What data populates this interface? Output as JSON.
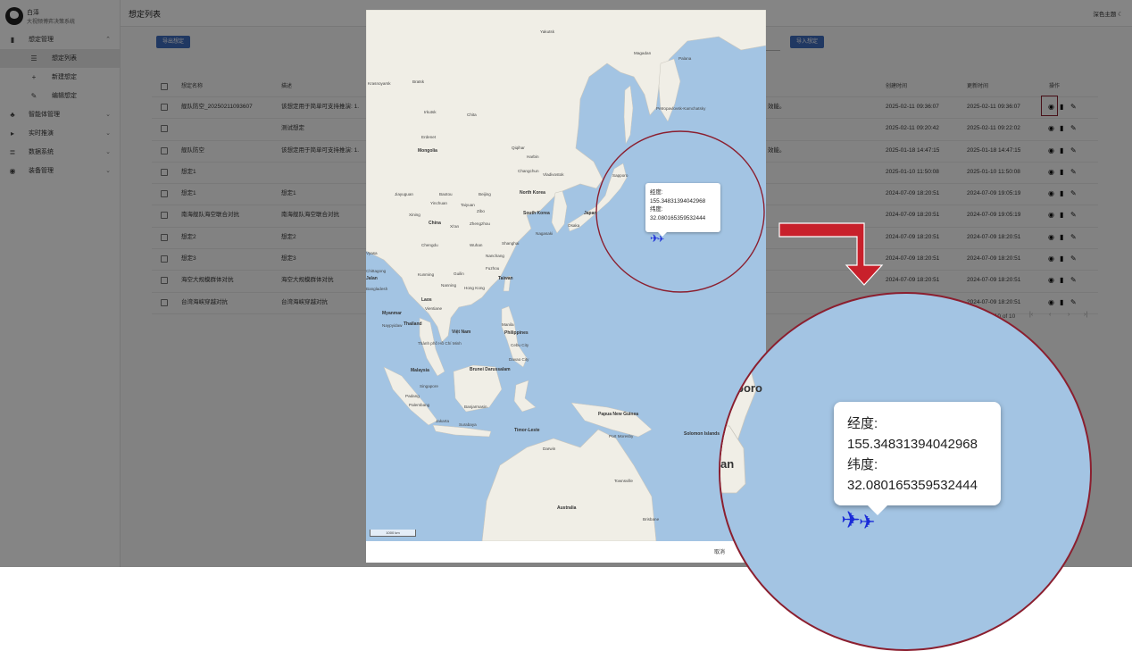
{
  "brand": {
    "title": "白泽",
    "subtitle": "大视频博弈决策系统"
  },
  "sidebar": {
    "items": [
      {
        "label": "想定管理",
        "icon": "map-icon",
        "chevron": "⌃"
      },
      {
        "label": "想定列表",
        "icon": "list-icon"
      },
      {
        "label": "新建想定",
        "icon": "plus-icon"
      },
      {
        "label": "编辑想定",
        "icon": "pencil-icon"
      },
      {
        "label": "智能体管理",
        "icon": "robot-icon",
        "chevron": "⌄"
      },
      {
        "label": "实时推演",
        "icon": "play-icon",
        "chevron": "⌄"
      },
      {
        "label": "数据系统",
        "icon": "database-icon",
        "chevron": "⌄"
      },
      {
        "label": "装备管理",
        "icon": "compass-icon",
        "chevron": "⌄"
      }
    ]
  },
  "header": {
    "title": "想定列表",
    "theme_toggle": "深色主题"
  },
  "toolbar": {
    "export_label": "导出想定",
    "import_label": "导入想定"
  },
  "table": {
    "headers": {
      "name": "想定名称",
      "desc": "描述",
      "created": "创建时间",
      "updated": "更新时间",
      "ops": "操作"
    },
    "rows": [
      {
        "name": "舰队防空_20250211093607",
        "desc": "该想定用于简单可支持推演: 1.",
        "extra": "效能。",
        "created": "2025-02-11 09:36:07",
        "updated": "2025-02-11 09:36:07"
      },
      {
        "name": "",
        "desc": "测试想定",
        "extra": "",
        "created": "2025-02-11 09:20:42",
        "updated": "2025-02-11 09:22:02"
      },
      {
        "name": "舰队防空",
        "desc": "该想定用于简单可支持推演: 1.",
        "extra": "效能。",
        "created": "2025-01-18 14:47:15",
        "updated": "2025-01-18 14:47:15"
      },
      {
        "name": "想定1",
        "desc": "",
        "extra": "",
        "created": "2025-01-10 11:50:08",
        "updated": "2025-01-10 11:50:08"
      },
      {
        "name": "想定1",
        "desc": "想定1",
        "extra": "",
        "created": "2024-07-09 18:20:51",
        "updated": "2024-07-09 19:05:19"
      },
      {
        "name": "南海舰队海空联合对抗",
        "desc": "南海舰队海空联合对抗",
        "extra": "",
        "created": "2024-07-09 18:20:51",
        "updated": "2024-07-09 19:05:19"
      },
      {
        "name": "想定2",
        "desc": "想定2",
        "extra": "",
        "created": "2024-07-09 18:20:51",
        "updated": "2024-07-09 18:20:51"
      },
      {
        "name": "想定3",
        "desc": "想定3",
        "extra": "",
        "created": "2024-07-09 18:20:51",
        "updated": "2024-07-09 18:20:51"
      },
      {
        "name": "海空大规模群体对抗",
        "desc": "海空大规模群体对抗",
        "extra": "",
        "created": "2024-07-09 18:20:51",
        "updated": "2024-07-09 18:20:51"
      },
      {
        "name": "台湾海峡穿越对抗",
        "desc": "台湾海峡穿越对抗",
        "extra": "",
        "created": "2024-07-09 18:20:51",
        "updated": "2024-07-09 18:20:51"
      }
    ],
    "pagination": "1-10 of 10"
  },
  "dialog": {
    "cancel_label": "取消",
    "popup": {
      "lon_label": "经度:",
      "lon": "155.34831394042968",
      "lat_label": "纬度:",
      "lat": "32.080165359532444"
    },
    "scale": "1000 km",
    "map_labels": [
      "Yakutsk",
      "Magadan",
      "Palana",
      "Krasnoyarsk",
      "Bratsk",
      "Irkutsk",
      "Chita",
      "Petropavlovsk-Kamchatsky",
      "Erdenet",
      "Mongolia",
      "Qiqihar",
      "Harbin",
      "Changchun",
      "Vladivostok",
      "Sapporo",
      "Baotou",
      "Beijing",
      "North Korea",
      "Jiayuguan",
      "Yinchuan",
      "Taiyuan",
      "Xining",
      "Zibo",
      "South Korea",
      "China",
      "Xi'an",
      "Zhengzhou",
      "Japan",
      "Osaka",
      "Nagasaki",
      "Chengdu",
      "Wuhan",
      "Shanghai",
      "Nanchang",
      "Fuzhou",
      "Kunming",
      "Guilin",
      "Taiwan",
      "Nanning",
      "Hong Kong",
      "Laos",
      "Myanmar",
      "Vientiane",
      "Naypyidaw",
      "Thailand",
      "Việt Nam",
      "Manila",
      "Philippines",
      "Thành phố Hồ Chí Minh",
      "Cebu City",
      "Davao City",
      "Malaysia",
      "Brunei Darussalam",
      "Singapore",
      "Padang",
      "Palembang",
      "Banjarmasin",
      "Jakarta",
      "Surabaya",
      "Papua New Guinea",
      "Port Moresby",
      "Timor-Leste",
      "Solomon Islands",
      "Darwin",
      "Townsville",
      "Australia",
      "Brisbane",
      "Vyasa",
      "Chittagong",
      "Jalan",
      "Bangladesh"
    ],
    "zoom_labels": [
      "poro",
      "an"
    ]
  },
  "colors": {
    "accent": "#3f6bbd",
    "highlight": "#8b1f2f",
    "arrow": "#c8202b",
    "plane": "#1a2bd8",
    "sea": "#a3c4e3"
  }
}
